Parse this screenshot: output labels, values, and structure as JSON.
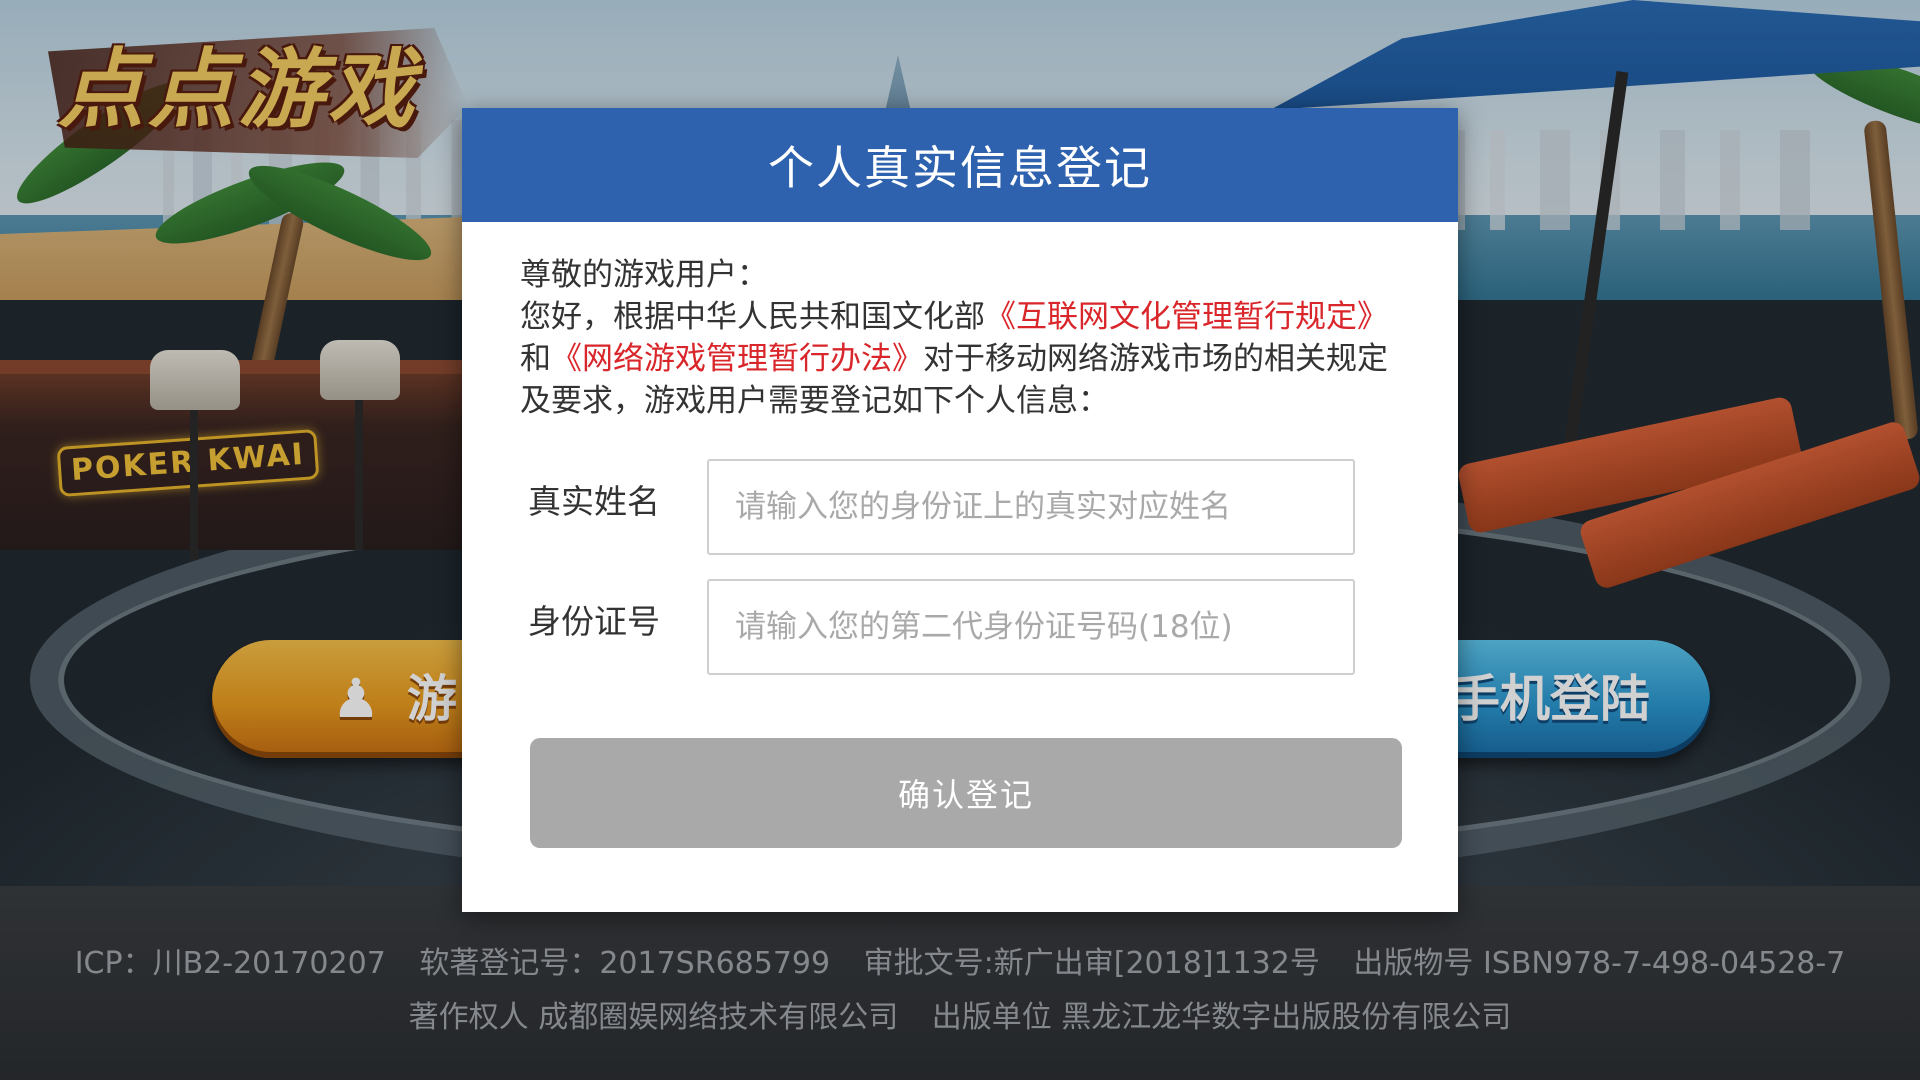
{
  "logo": {
    "text": "点点游戏"
  },
  "scene": {
    "neon_sign": "POKER KWAI"
  },
  "login_buttons": {
    "guest_label": "游",
    "phone_label": "手机登陆"
  },
  "modal": {
    "title": "个人真实信息登记",
    "notice": {
      "greeting": "尊敬的游戏用户：",
      "line_start": "您好，根据中华人民共和国文化部",
      "regulation_1": "《互联网文化管理暂行规定》",
      "connector": "和",
      "regulation_2": "《网络游戏管理暂行办法》",
      "line_end": "对于移动网络游戏市场的相关规定及要求，游戏用户需要登记如下个人信息："
    },
    "name_field": {
      "label": "真实姓名",
      "placeholder": "请输入您的身份证上的真实对应姓名",
      "value": ""
    },
    "id_field": {
      "label": "身份证号",
      "placeholder": "请输入您的第二代身份证号码(18位)",
      "value": ""
    },
    "confirm_label": "确认登记"
  },
  "footer": {
    "icp": "ICP：川B2-20170207",
    "software_reg": "软著登记号：2017SR685799",
    "approval": "审批文号:新广出审[2018]1132号",
    "publication": "出版物号 ISBN978-7-498-04528-7",
    "copyright": "著作权人 成都圈娱网络技术有限公司",
    "publisher": "出版单位  黑龙江龙华数字出版股份有限公司"
  },
  "colors": {
    "header_blue": "#2e62ae",
    "regulation_red": "#d9262b",
    "button_disabled_gray": "#a9a9a9",
    "footer_bg": "#2c2f33"
  }
}
